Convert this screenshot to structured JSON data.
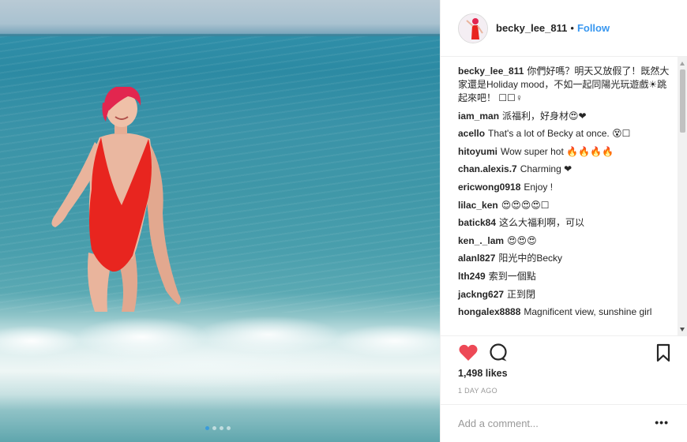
{
  "post": {
    "username": "becky_lee_811",
    "separator": "•",
    "follow_label": "Follow",
    "likes": "1,498 likes",
    "time": "1 DAY AGO",
    "comment_placeholder": "Add a comment...",
    "more_label": "•••",
    "carousel": {
      "count": 4,
      "active_index": 0
    }
  },
  "comments": [
    {
      "user": "becky_lee_811",
      "text": "你們好嗎？明天又放假了！既然大家還是Holiday mood，不如一起同陽光玩遊戲☀跳起來吧！ ☐☐♀"
    },
    {
      "user": "iam_man",
      "text": "派福利，好身材😍❤"
    },
    {
      "user": "acello",
      "text": "That's a lot of Becky at once. 😵☐"
    },
    {
      "user": "hitoyumi",
      "text": "Wow super hot 🔥🔥🔥🔥"
    },
    {
      "user": "chan.alexis.7",
      "text": "Charming ❤"
    },
    {
      "user": "ericwong0918",
      "text": "Enjoy !"
    },
    {
      "user": "lilac_ken",
      "text": "😍😍😍😍☐"
    },
    {
      "user": "batick84",
      "text": "这么大福利啊，可以"
    },
    {
      "user": "ken_._lam",
      "text": "😍😍😍"
    },
    {
      "user": "alanl827",
      "text": "阳光中的Becky"
    },
    {
      "user": "lth249",
      "text": "索到一個點"
    },
    {
      "user": "jackng627",
      "text": "正到閉"
    },
    {
      "user": "hongalex8888",
      "text": "Magnificent view, sunshine girl"
    }
  ],
  "colors": {
    "like_heart": "#ed4956",
    "follow": "#3897f0",
    "swimsuit": "#e8251f",
    "hair": "#e2264f"
  },
  "icons": {
    "like": "heart-icon",
    "comment": "comment-bubble-icon",
    "save": "bookmark-icon"
  }
}
